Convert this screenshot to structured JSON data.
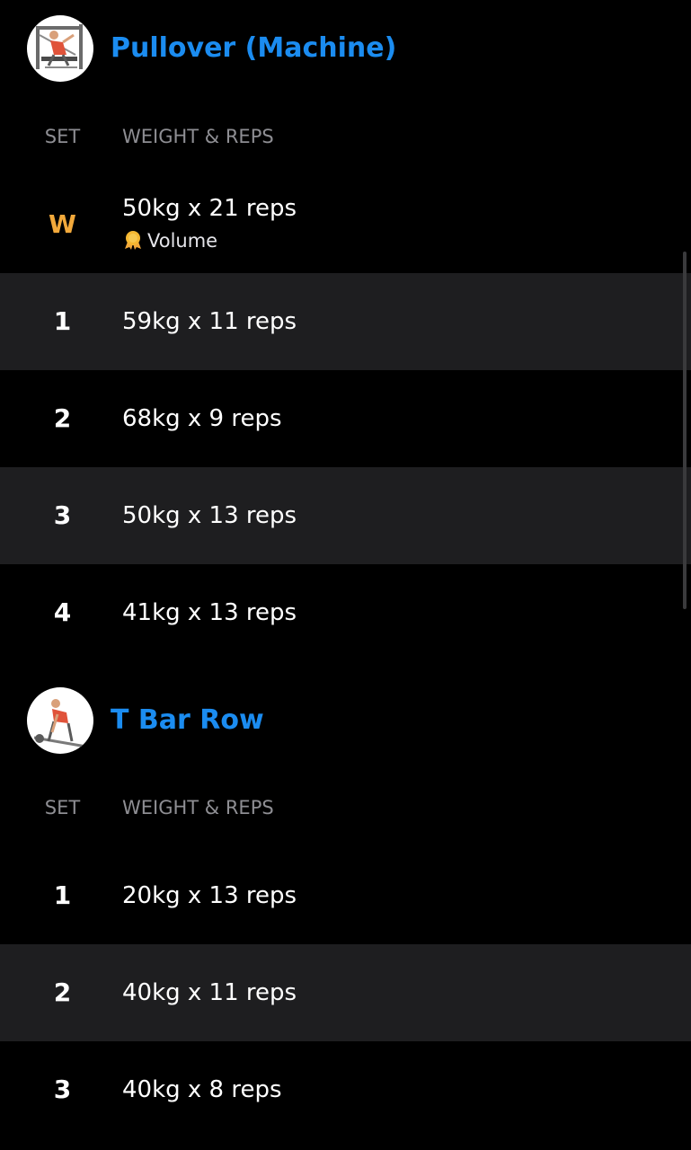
{
  "columns": {
    "set_label": "SET",
    "weight_reps_label": "WEIGHT & REPS"
  },
  "colors": {
    "background": "#000000",
    "row_shade": "#1e1e20",
    "title_blue": "#1b8cf0",
    "warmup_orange": "#f2a93b",
    "muted_text": "#8e8e93"
  },
  "exercises": [
    {
      "title": "Pullover (Machine)",
      "thumbnail_icon": "pullover-machine-icon",
      "sets": [
        {
          "set": "W",
          "type": "warmup",
          "value": "50kg x 21 reps",
          "badge": {
            "icon": "medal-icon",
            "label": "Volume"
          }
        },
        {
          "set": "1",
          "type": "normal",
          "value": "59kg x 11 reps"
        },
        {
          "set": "2",
          "type": "normal",
          "value": "68kg x 9 reps"
        },
        {
          "set": "3",
          "type": "normal",
          "value": "50kg x 13 reps"
        },
        {
          "set": "4",
          "type": "normal",
          "value": "41kg x 13 reps"
        }
      ]
    },
    {
      "title": "T Bar Row",
      "thumbnail_icon": "t-bar-row-icon",
      "sets": [
        {
          "set": "1",
          "type": "normal",
          "value": "20kg x 13 reps"
        },
        {
          "set": "2",
          "type": "normal",
          "value": "40kg x 11 reps"
        },
        {
          "set": "3",
          "type": "normal",
          "value": "40kg x 8 reps"
        }
      ]
    }
  ]
}
